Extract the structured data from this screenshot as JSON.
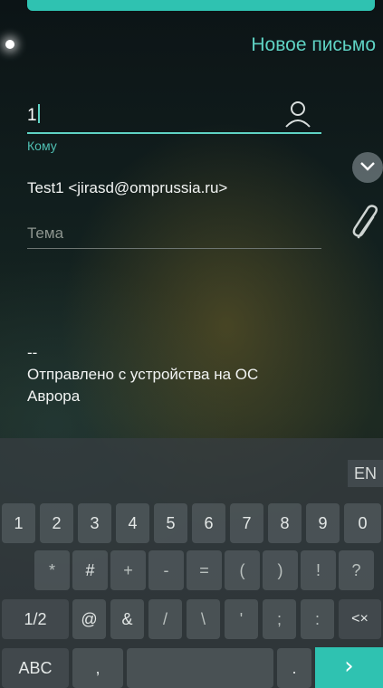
{
  "header": {
    "title": "Новое письмо"
  },
  "compose": {
    "to_value": "1",
    "to_label": "Кому",
    "recipient": "Test1 <jirasd@omprussia.ru>",
    "subject_placeholder": "Тема",
    "signature_lines": [
      "--",
      "Отправлено с устройства на ОС",
      "Аврора"
    ]
  },
  "keyboard": {
    "language": "EN",
    "row1": [
      "1",
      "2",
      "3",
      "4",
      "5",
      "6",
      "7",
      "8",
      "9",
      "0"
    ],
    "row2": [
      "*",
      "#",
      "+",
      "-",
      "=",
      "(",
      ")",
      "!",
      "?"
    ],
    "row3": [
      "1/2",
      "@",
      "&",
      "/",
      "\\",
      "'",
      ";",
      ":",
      "<×"
    ],
    "row4": {
      "abc": "ABC",
      "comma": ",",
      "period": ".",
      "enter": "›"
    }
  },
  "colors": {
    "accent": "#2fc2b1",
    "highlight_text": "#5fd3c4"
  },
  "icons": [
    "contact-icon",
    "chevron-down-icon",
    "paperclip-icon",
    "backspace-icon",
    "arrow-right-icon"
  ]
}
